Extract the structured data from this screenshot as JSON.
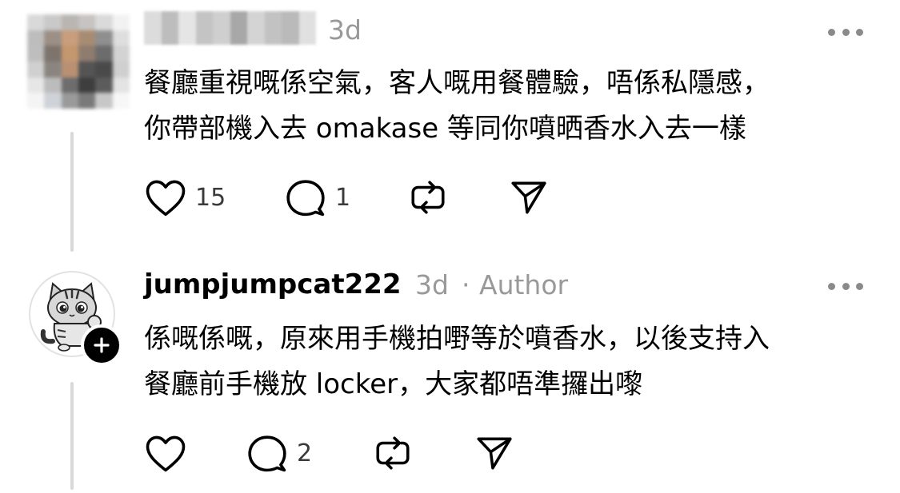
{
  "comments": [
    {
      "time": "3d",
      "text_lines": [
        "餐廳重視嘅係空氣，客人嘅用餐體驗，唔係私隱感，",
        "你帶部機入去 omakase 等同你噴晒香水入去一樣"
      ],
      "likes": "15",
      "replies": "1"
    },
    {
      "username": "jumpjumpcat222",
      "time": "3d",
      "separator": "·",
      "author_tag": "Author",
      "text_lines": [
        "係嘅係嘅，原來用手機拍嘢等於噴香水，以後支持入",
        "餐廳前手機放 locker，大家都唔準攞出嚟"
      ],
      "likes": "",
      "replies": "2"
    }
  ],
  "icons": {
    "more": "more-horizontal-icon",
    "like": "heart-icon",
    "reply": "comment-bubble-icon",
    "repost": "repost-icon",
    "share": "send-icon",
    "follow": "plus-icon"
  },
  "colors": {
    "text": "#000000",
    "meta": "#999999",
    "thread_line": "#d9d9d9"
  }
}
